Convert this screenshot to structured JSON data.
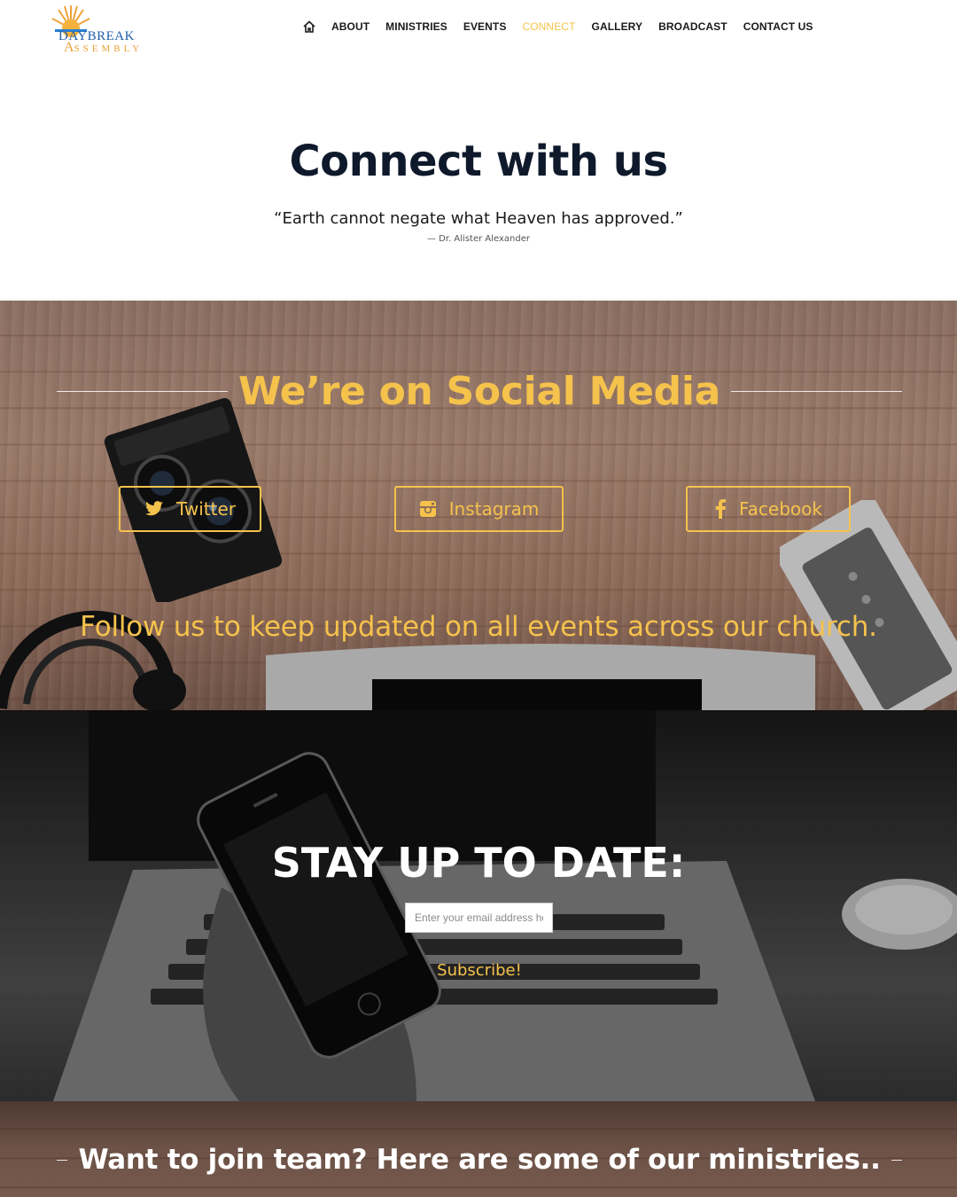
{
  "brand": {
    "line1": "DAYBREAK",
    "line2_initial": "A",
    "line2_rest": "SSEMBLY",
    "colors": {
      "blue": "#1f5fa8",
      "orange": "#e8a23a"
    }
  },
  "nav": {
    "home_icon": "home-icon",
    "items": [
      {
        "label": "ABOUT",
        "active": false
      },
      {
        "label": "MINISTRIES",
        "active": false
      },
      {
        "label": "EVENTS",
        "active": false
      },
      {
        "label": "CONNECT",
        "active": true
      },
      {
        "label": "GALLERY",
        "active": false
      },
      {
        "label": "BROADCAST",
        "active": false
      },
      {
        "label": "CONTACT US",
        "active": false
      }
    ]
  },
  "intro": {
    "title": "Connect with us",
    "quote": "“Earth cannot negate what Heaven has approved.”",
    "author": "— Dr. Alister Alexander"
  },
  "social": {
    "title": "We’re on Social Media",
    "buttons": [
      {
        "label": "Twitter",
        "icon": "twitter-icon"
      },
      {
        "label": "Instagram",
        "icon": "instagram-icon"
      },
      {
        "label": "Facebook",
        "icon": "facebook-icon"
      }
    ],
    "subtitle": "Follow us to keep updated on all events across our church."
  },
  "subscribe": {
    "title": "STAY UP TO DATE:",
    "email_placeholder": "Enter your email address he",
    "button_label": "Subscribe!"
  },
  "ministries": {
    "title": "Want to join team? Here are some of our ministries.."
  },
  "colors": {
    "accent": "#f5c24c",
    "text_dark": "#0e1a2b",
    "white": "#ffffff"
  }
}
